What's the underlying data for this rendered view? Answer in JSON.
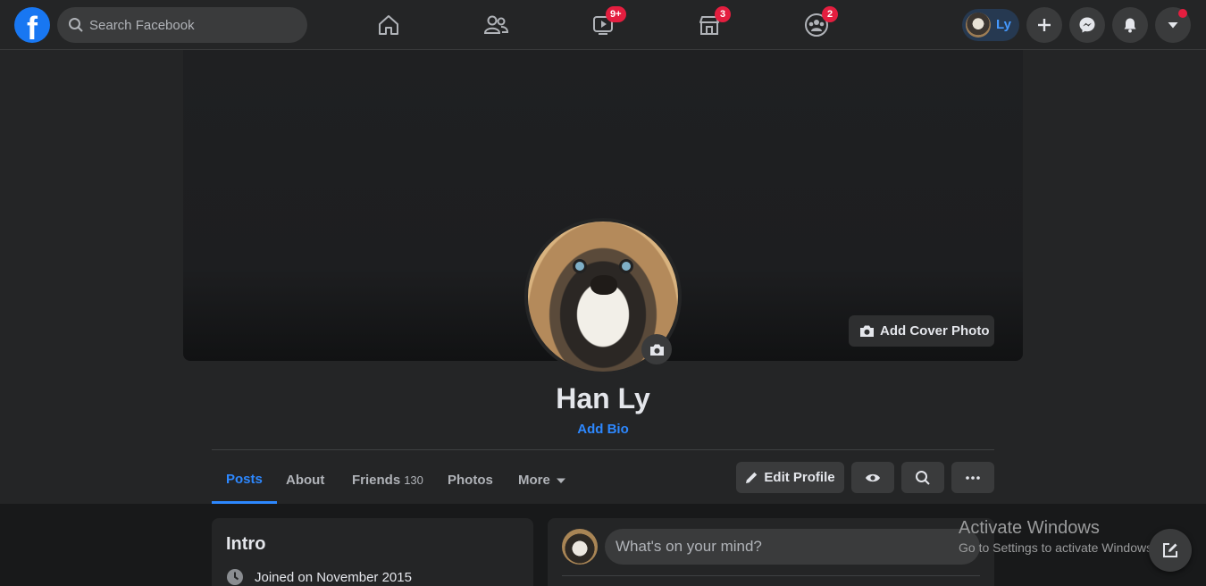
{
  "header": {
    "search_placeholder": "Search Facebook",
    "badges": {
      "watch": "9+",
      "marketplace": "3",
      "groups": "2"
    },
    "user_short_name": "Ly"
  },
  "profile": {
    "name": "Han Ly",
    "add_bio": "Add Bio",
    "add_cover_label": "Add Cover Photo"
  },
  "tabs": [
    {
      "label": "Posts"
    },
    {
      "label": "About"
    },
    {
      "label": "Friends",
      "count": "130"
    },
    {
      "label": "Photos"
    },
    {
      "label": "More"
    }
  ],
  "actions": {
    "edit_profile": "Edit Profile"
  },
  "intro": {
    "title": "Intro",
    "joined": "Joined on November 2015"
  },
  "composer": {
    "placeholder": "What's on your mind?"
  },
  "watermark": {
    "title": "Activate Windows",
    "subtitle": "Go to Settings to activate Windows."
  },
  "colors": {
    "accent": "#2d88ff",
    "badge": "#e41e3f",
    "surface": "#242526",
    "background": "#18191a"
  }
}
